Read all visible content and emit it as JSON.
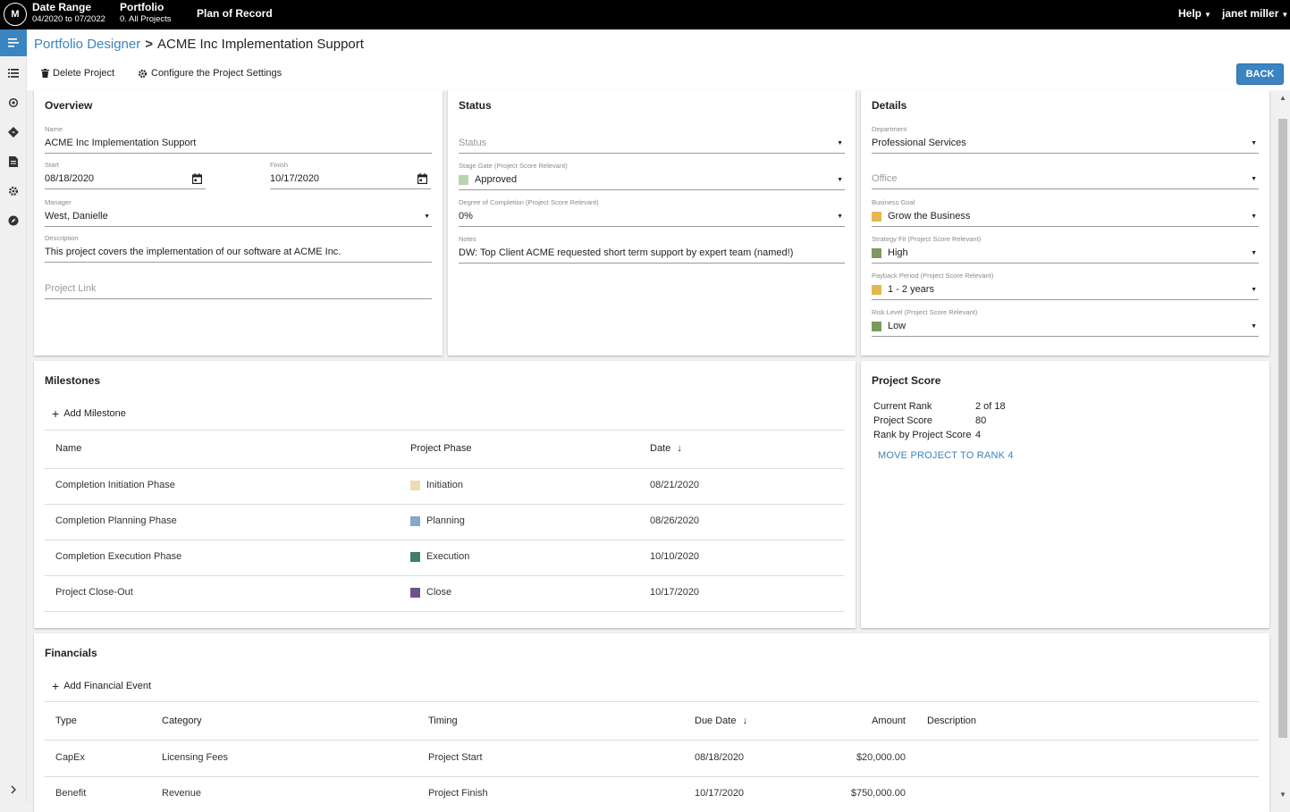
{
  "topbar": {
    "logo": "M",
    "date_range": {
      "title": "Date Range",
      "value": "04/2020 to 07/2022"
    },
    "portfolio": {
      "title": "Portfolio",
      "value": "0. All Projects"
    },
    "plan": "Plan of Record",
    "help": "Help",
    "user": "janet miller"
  },
  "rail": {
    "icons": [
      "menu-icon",
      "list-icon",
      "target-icon",
      "diamond-icon",
      "document-icon",
      "gear-icon",
      "compass-icon",
      "chevron-right-icon"
    ]
  },
  "header": {
    "breadcrumb_root": "Portfolio Designer",
    "breadcrumb_sep": ">",
    "breadcrumb_current": "ACME Inc Implementation Support",
    "delete_label": "Delete Project",
    "configure_label": "Configure the Project Settings",
    "back_label": "BACK"
  },
  "overview": {
    "title": "Overview",
    "name_label": "Name",
    "name_value": "ACME Inc Implementation Support",
    "start_label": "Start",
    "start_value": "08/18/2020",
    "finish_label": "Finish",
    "finish_value": "10/17/2020",
    "manager_label": "Manager",
    "manager_value": "West, Danielle",
    "description_label": "Description",
    "description_value": "This project covers the implementation of our software at ACME Inc.",
    "link_placeholder": "Project Link"
  },
  "status": {
    "title": "Status",
    "status_placeholder": "Status",
    "stage_gate_label": "Stage Gate (Project Score Relevant)",
    "stage_gate_value": "Approved",
    "stage_gate_color": "#b9d4b3",
    "completion_label": "Degree of Completion (Project Score Relevant)",
    "completion_value": "0%",
    "notes_label": "Notes",
    "notes_value": "DW: Top Client ACME requested short term support by expert team (named!)"
  },
  "details": {
    "title": "Details",
    "department_label": "Department",
    "department_value": "Professional Services",
    "office_placeholder": "Office",
    "goal_label": "Business Goal",
    "goal_value": "Grow the Business",
    "goal_color": "#e3b94e",
    "strategy_label": "Strategy Fit (Project Score Relevant)",
    "strategy_value": "High",
    "strategy_color": "#7a9a5e",
    "payback_label": "Payback Period (Project Score Relevant)",
    "payback_value": "1 - 2 years",
    "payback_color": "#e3b94e",
    "risk_label": "Risk Level (Project Score Relevant)",
    "risk_value": "Low",
    "risk_color": "#7a9a5e"
  },
  "milestones": {
    "title": "Milestones",
    "add_label": "Add Milestone",
    "col_name": "Name",
    "col_phase": "Project Phase",
    "col_date": "Date",
    "rows": [
      {
        "name": "Completion Initiation Phase",
        "phase": "Initiation",
        "color": "#ecdcb0",
        "date": "08/21/2020"
      },
      {
        "name": "Completion Planning Phase",
        "phase": "Planning",
        "color": "#86a8d0",
        "date": "08/26/2020"
      },
      {
        "name": "Completion Execution Phase",
        "phase": "Execution",
        "color": "#3f7f65",
        "date": "10/10/2020"
      },
      {
        "name": "Project Close-Out",
        "phase": "Close",
        "color": "#6d5489",
        "date": "10/17/2020"
      }
    ]
  },
  "score": {
    "title": "Project Score",
    "rank_label": "Current Rank",
    "rank_value": "2 of 18",
    "score_label": "Project Score",
    "score_value": "80",
    "by_score_label": "Rank by Project Score",
    "by_score_value": "4",
    "move_label": "MOVE PROJECT TO RANK 4"
  },
  "financials": {
    "title": "Financials",
    "add_label": "Add Financial Event",
    "col_type": "Type",
    "col_category": "Category",
    "col_timing": "Timing",
    "col_due": "Due Date",
    "col_amount": "Amount",
    "col_description": "Description",
    "rows": [
      {
        "type": "CapEx",
        "category": "Licensing Fees",
        "timing": "Project Start",
        "due": "08/18/2020",
        "amount": "$20,000.00",
        "description": ""
      },
      {
        "type": "Benefit",
        "category": "Revenue",
        "timing": "Project Finish",
        "due": "10/17/2020",
        "amount": "$750,000.00",
        "description": ""
      }
    ]
  }
}
